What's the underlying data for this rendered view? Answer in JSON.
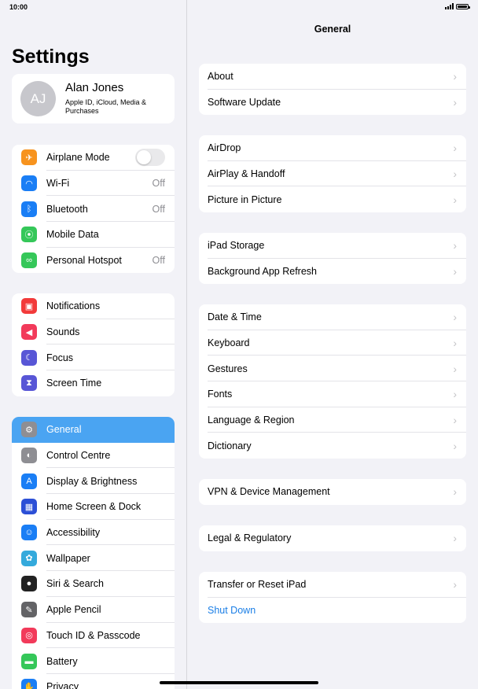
{
  "status": {
    "time": "10:00"
  },
  "sidebar": {
    "title": "Settings",
    "profile": {
      "initials": "AJ",
      "name": "Alan Jones",
      "subtitle": "Apple ID, iCloud, Media & Purchases"
    },
    "groups": [
      [
        {
          "label": "Airplane Mode",
          "icon": "airplane-icon",
          "color": "#f7931e",
          "value": "",
          "toggle": true
        },
        {
          "label": "Wi-Fi",
          "icon": "wifi-icon",
          "color": "#1a7ef5",
          "value": "Off"
        },
        {
          "label": "Bluetooth",
          "icon": "bluetooth-icon",
          "color": "#1a7ef5",
          "value": "Off"
        },
        {
          "label": "Mobile Data",
          "icon": "antenna-icon",
          "color": "#35c759",
          "value": ""
        },
        {
          "label": "Personal Hotspot",
          "icon": "hotspot-icon",
          "color": "#35c759",
          "value": "Off"
        }
      ],
      [
        {
          "label": "Notifications",
          "icon": "notifications-icon",
          "color": "#f23a3a",
          "value": ""
        },
        {
          "label": "Sounds",
          "icon": "speaker-icon",
          "color": "#f23a5a",
          "value": ""
        },
        {
          "label": "Focus",
          "icon": "moon-icon",
          "color": "#5856d6",
          "value": ""
        },
        {
          "label": "Screen Time",
          "icon": "hourglass-icon",
          "color": "#5856d6",
          "value": ""
        }
      ],
      [
        {
          "label": "General",
          "icon": "gear-icon",
          "color": "#8e8e93",
          "value": "",
          "selected": true
        },
        {
          "label": "Control Centre",
          "icon": "switches-icon",
          "color": "#8e8e93",
          "value": ""
        },
        {
          "label": "Display & Brightness",
          "icon": "text-size-icon",
          "color": "#1a7ef5",
          "value": ""
        },
        {
          "label": "Home Screen & Dock",
          "icon": "grid-icon",
          "color": "#2c4fd6",
          "value": ""
        },
        {
          "label": "Accessibility",
          "icon": "accessibility-icon",
          "color": "#1a7ef5",
          "value": ""
        },
        {
          "label": "Wallpaper",
          "icon": "flower-icon",
          "color": "#34aadc",
          "value": ""
        },
        {
          "label": "Siri & Search",
          "icon": "siri-icon",
          "color": "#222222",
          "value": ""
        },
        {
          "label": "Apple Pencil",
          "icon": "pencil-icon",
          "color": "#636366",
          "value": ""
        },
        {
          "label": "Touch ID & Passcode",
          "icon": "fingerprint-icon",
          "color": "#f23a5a",
          "value": ""
        },
        {
          "label": "Battery",
          "icon": "battery-icon",
          "color": "#35c759",
          "value": ""
        },
        {
          "label": "Privacy",
          "icon": "hand-icon",
          "color": "#1a7ef5",
          "value": ""
        }
      ]
    ]
  },
  "main": {
    "title": "General",
    "groups": [
      [
        "About",
        "Software Update"
      ],
      [
        "AirDrop",
        "AirPlay & Handoff",
        "Picture in Picture"
      ],
      [
        "iPad Storage",
        "Background App Refresh"
      ],
      [
        "Date & Time",
        "Keyboard",
        "Gestures",
        "Fonts",
        "Language & Region",
        "Dictionary"
      ],
      [
        "VPN & Device Management"
      ],
      [
        "Legal & Regulatory"
      ],
      [
        "Transfer or Reset iPad",
        "Shut Down"
      ]
    ],
    "link_color": "#1a7ee6"
  }
}
